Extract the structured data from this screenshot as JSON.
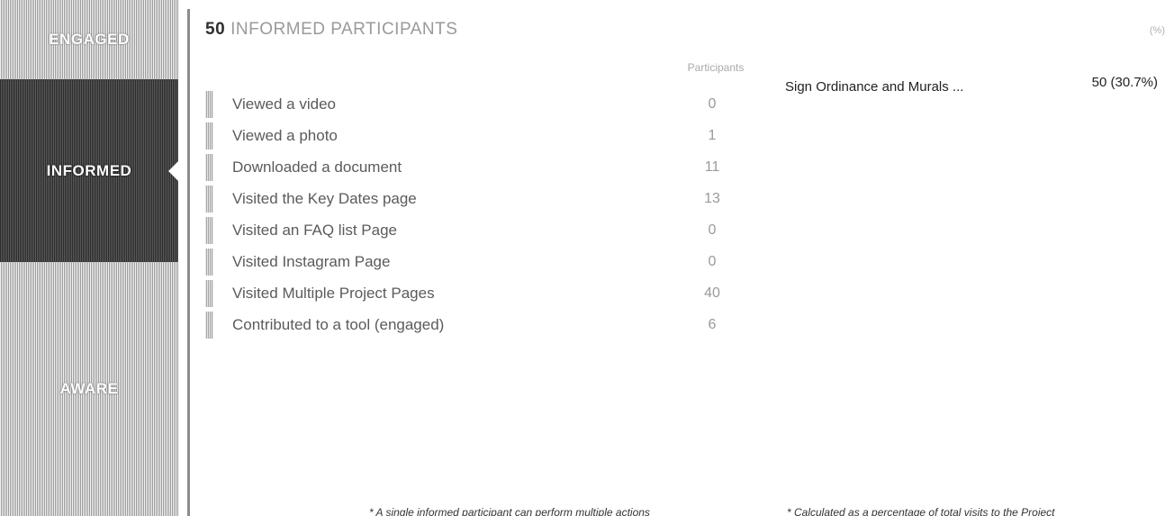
{
  "funnel": {
    "stages": {
      "engaged": "ENGAGED",
      "informed": "INFORMED",
      "aware": "AWARE"
    }
  },
  "header": {
    "count": "50",
    "title": "INFORMED PARTICIPANTS",
    "percent_hint": "(%)"
  },
  "table": {
    "column_header": "Participants",
    "rows": [
      {
        "label": "Viewed a video",
        "value": "0"
      },
      {
        "label": "Viewed a photo",
        "value": "1"
      },
      {
        "label": "Downloaded a document",
        "value": "11"
      },
      {
        "label": "Visited the Key Dates page",
        "value": "13"
      },
      {
        "label": "Visited an FAQ list Page",
        "value": "0"
      },
      {
        "label": "Visited Instagram Page",
        "value": "0"
      },
      {
        "label": "Visited Multiple Project Pages",
        "value": "40"
      },
      {
        "label": "Contributed to a tool (engaged)",
        "value": "6"
      }
    ]
  },
  "project": {
    "name": "Sign Ordinance and Murals ...",
    "value": "50 (30.7%)"
  },
  "footnotes": {
    "left": "* A single informed participant can perform multiple actions",
    "right": "* Calculated as a percentage of total visits to the Project"
  }
}
